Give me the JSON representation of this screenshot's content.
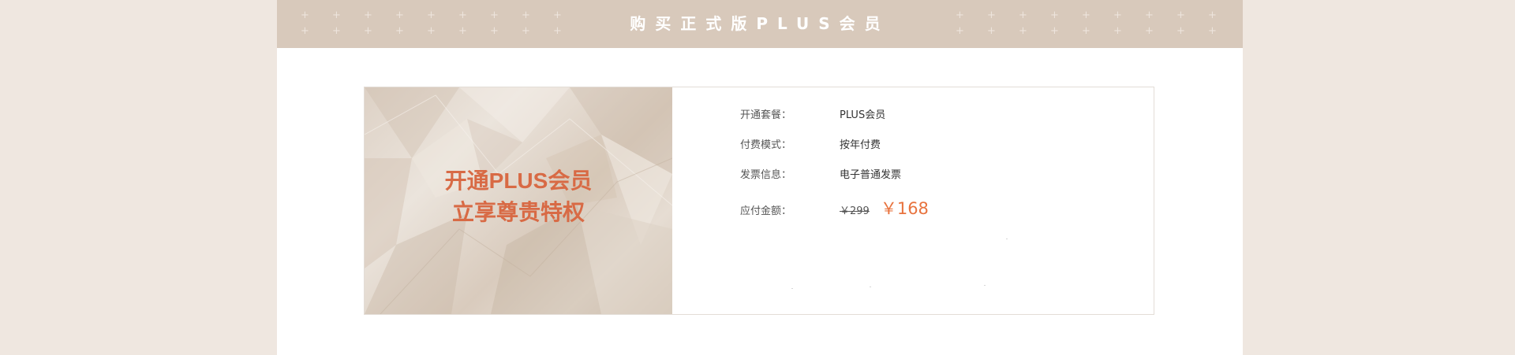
{
  "header": {
    "title": "购买正式版PLUS会员",
    "decor_symbol": "+"
  },
  "banner": {
    "line1": "开通PLUS会员",
    "line2": "立享尊贵特权"
  },
  "order": {
    "plan_label": "开通套餐：",
    "plan_value": "PLUS会员",
    "mode_label": "付费模式：",
    "mode_value": "按年付费",
    "invoice_label": "发票信息：",
    "invoice_value": "电子普通发票",
    "amount_label": "应付金额：",
    "original_price": "￥299",
    "price": "￥168"
  },
  "colors": {
    "background": "#efe7e0",
    "header": "#d8c9bb",
    "accent": "#d86a45",
    "price": "#e8733e"
  }
}
